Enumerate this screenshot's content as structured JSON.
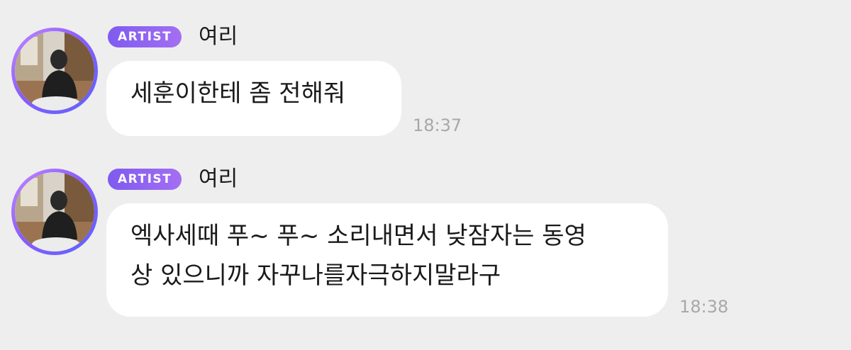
{
  "messages": [
    {
      "badge": "ARTIST",
      "sender": "여리",
      "text": "세훈이한테 좀 전해줘",
      "time": "18:37"
    },
    {
      "badge": "ARTIST",
      "sender": "여리",
      "text": "엑사세때 푸~ 푸~ 소리내면서 낮잠자는 동영\n상 있으니까 자꾸나를자극하지말라구",
      "time": "18:38"
    }
  ],
  "colors": {
    "background": "#eeeeee",
    "bubble": "#ffffff",
    "badge_start": "#7e5bf0",
    "badge_end": "#a46ef2",
    "avatar_ring": "#8a5cff",
    "timestamp": "#a8a8a8"
  }
}
